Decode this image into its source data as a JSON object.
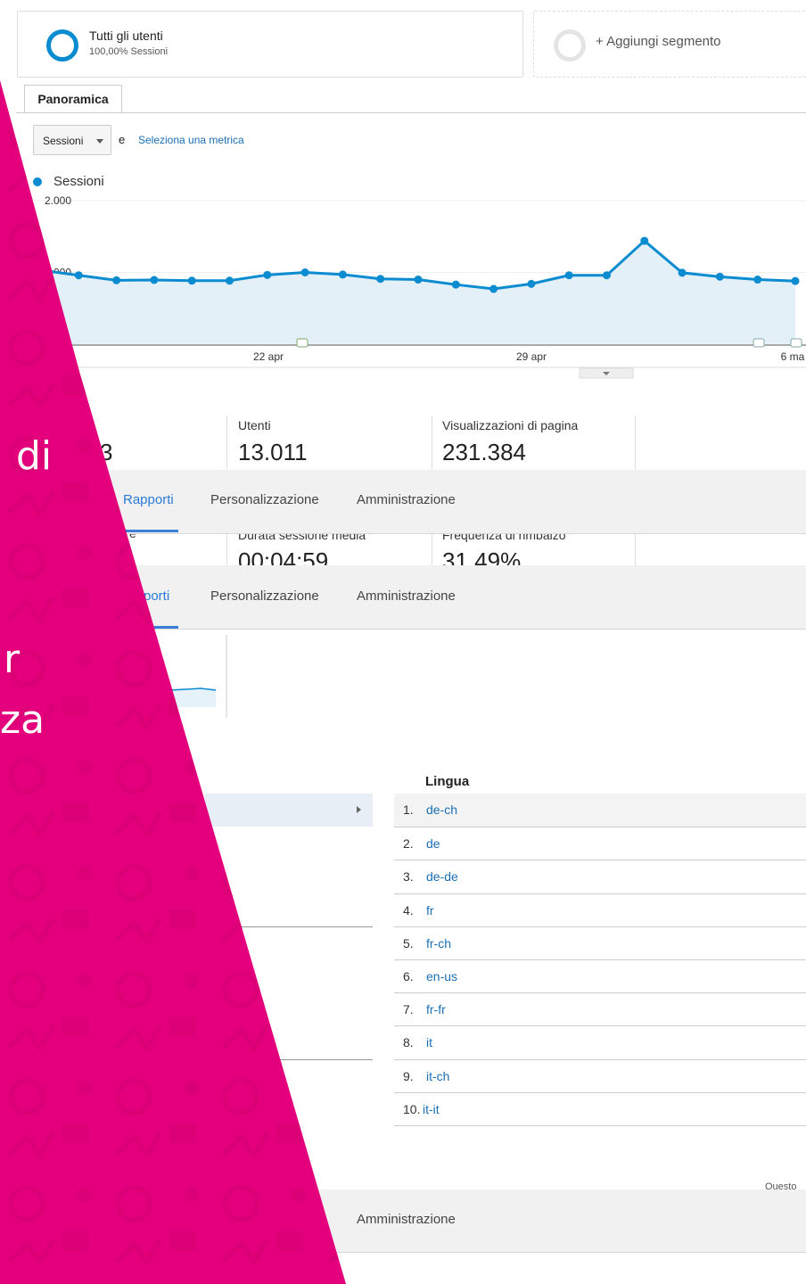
{
  "segments": {
    "all_users_title": "Tutti gli utenti",
    "all_users_sub": "100,00% Sessioni",
    "add_segment": "+ Aggiungi segmento"
  },
  "tabs": {
    "overview": "Panoramica"
  },
  "metric_picker": {
    "selected": "Sessioni",
    "conj": "e",
    "select_link": "Seleziona una metrica"
  },
  "chart_data": {
    "type": "line",
    "legend": "Sessioni",
    "series_color": "#0b8bd0",
    "y_ticks": [
      "2.000",
      "1.000"
    ],
    "ylim": [
      0,
      2000
    ],
    "x_labels": [
      "22 apr",
      "29 apr",
      "6 ma"
    ],
    "values": [
      1030,
      960,
      890,
      895,
      885,
      885,
      965,
      1000,
      970,
      910,
      900,
      830,
      770,
      840,
      960,
      960,
      1440,
      995,
      940,
      900,
      880
    ],
    "grid": true
  },
  "metrics": {
    "partial_left": "3",
    "users_label": "Utenti",
    "users_value": "13.011",
    "pageviews_label": "Visualizzazioni di pagina",
    "pageviews_value": "231.384",
    "duration_label": "Durata sessione media",
    "duration_value": "00:04:59",
    "bounce_label": "Frequenza di rimbalzo",
    "bounce_value": "31,49%",
    "partial_e": "e"
  },
  "nav": {
    "rapporti": "Rapporti",
    "rapporti_cut": "porti",
    "personalizzazione": "Personalizzazione",
    "amministrazione": "Amministrazione"
  },
  "language_table": {
    "header": "Lingua",
    "rows": [
      {
        "n": "1.",
        "lang": "de-ch"
      },
      {
        "n": "2.",
        "lang": "de"
      },
      {
        "n": "3.",
        "lang": "de-de"
      },
      {
        "n": "4.",
        "lang": "fr"
      },
      {
        "n": "5.",
        "lang": "fr-ch"
      },
      {
        "n": "6.",
        "lang": "en-us"
      },
      {
        "n": "7.",
        "lang": "fr-fr"
      },
      {
        "n": "8.",
        "lang": "it"
      },
      {
        "n": "9.",
        "lang": "it-ch"
      },
      {
        "n": "10.",
        "lang": "it-it"
      }
    ],
    "footer_partial": "Questo"
  },
  "overlay": {
    "color": "#e4007c",
    "text_di": "di",
    "text_r": "r",
    "text_za": "za"
  }
}
